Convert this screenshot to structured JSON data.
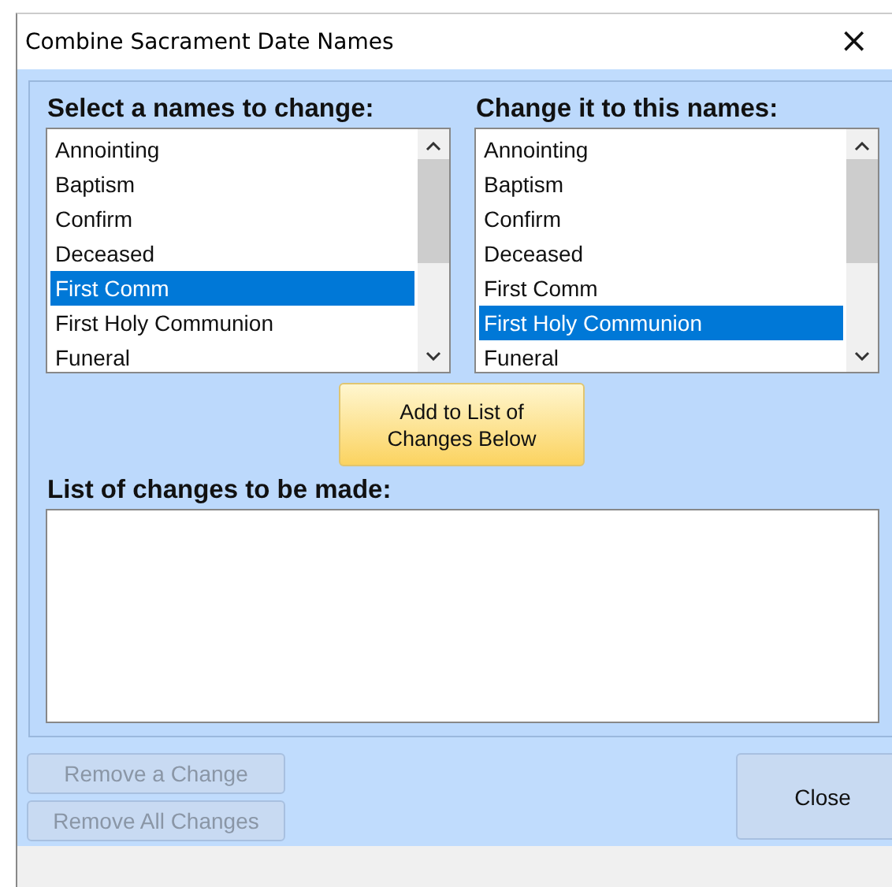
{
  "window": {
    "title": "Combine Sacrament Date Names",
    "close": "×"
  },
  "source_list": {
    "label": "Select a names to change:",
    "items": [
      {
        "text": "Annointing",
        "selected": false
      },
      {
        "text": "Baptism",
        "selected": false
      },
      {
        "text": "Confirm",
        "selected": false
      },
      {
        "text": "Deceased",
        "selected": false
      },
      {
        "text": "First Comm",
        "selected": true
      },
      {
        "text": "First Holy Communion",
        "selected": false
      },
      {
        "text": "Funeral",
        "selected": false
      }
    ]
  },
  "target_list": {
    "label": "Change it to this names:",
    "items": [
      {
        "text": "Annointing",
        "selected": false
      },
      {
        "text": "Baptism",
        "selected": false
      },
      {
        "text": "Confirm",
        "selected": false
      },
      {
        "text": "Deceased",
        "selected": false
      },
      {
        "text": "First Comm",
        "selected": false
      },
      {
        "text": "First Holy Communion",
        "selected": true
      },
      {
        "text": "Funeral",
        "selected": false
      }
    ]
  },
  "add_button": {
    "label": "Add to List of Changes Below"
  },
  "changes": {
    "label": "List of changes to be made:"
  },
  "buttons": [
    {
      "label": "Remove a Change",
      "disabled": true
    },
    {
      "label": "Remove All Changes",
      "disabled": true
    },
    {
      "label": "Close",
      "disabled": false
    }
  ]
}
